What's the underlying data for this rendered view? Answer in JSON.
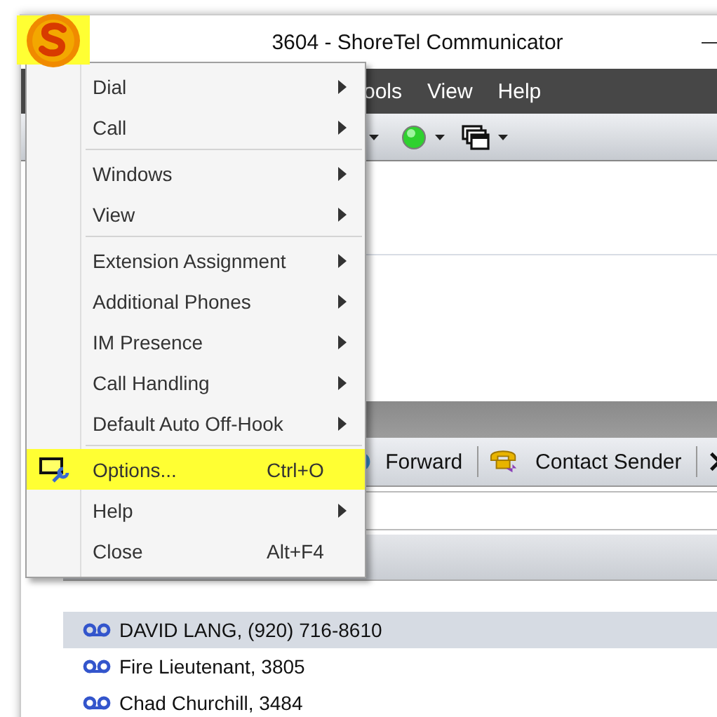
{
  "window": {
    "title": "3604 - ShoreTel Communicator"
  },
  "app_logo": {
    "highlighted": true
  },
  "menubar": [
    "ools",
    "View",
    "Help"
  ],
  "voicemail_toolbar": {
    "buttons": [
      {
        "label": "Forward"
      },
      {
        "label": "Contact Sender"
      }
    ]
  },
  "voicemail_list": [
    {
      "text": "DAVID LANG, (920) 716-8610",
      "selected": true
    },
    {
      "text": "Fire Lieutenant, 3805",
      "selected": false
    },
    {
      "text": "Chad Churchill, 3484",
      "selected": false
    }
  ],
  "app_menu": {
    "items": [
      {
        "kind": "item",
        "label": "Dial",
        "submenu": true
      },
      {
        "kind": "item",
        "label": "Call",
        "submenu": true
      },
      {
        "kind": "separator"
      },
      {
        "kind": "item",
        "label": "Windows",
        "submenu": true
      },
      {
        "kind": "item",
        "label": "View",
        "submenu": true
      },
      {
        "kind": "separator"
      },
      {
        "kind": "item",
        "label": "Extension Assignment",
        "submenu": true
      },
      {
        "kind": "item",
        "label": "Additional Phones",
        "submenu": true
      },
      {
        "kind": "item",
        "label": "IM Presence",
        "submenu": true
      },
      {
        "kind": "item",
        "label": "Call Handling",
        "submenu": true
      },
      {
        "kind": "item",
        "label": "Default Auto Off-Hook",
        "submenu": true
      },
      {
        "kind": "separator"
      },
      {
        "kind": "item",
        "label": "Options...",
        "shortcut": "Ctrl+O",
        "icon": true,
        "highlighted": true
      },
      {
        "kind": "item",
        "label": "Help",
        "submenu": true
      },
      {
        "kind": "item",
        "label": "Close",
        "shortcut": "Alt+F4"
      }
    ]
  }
}
